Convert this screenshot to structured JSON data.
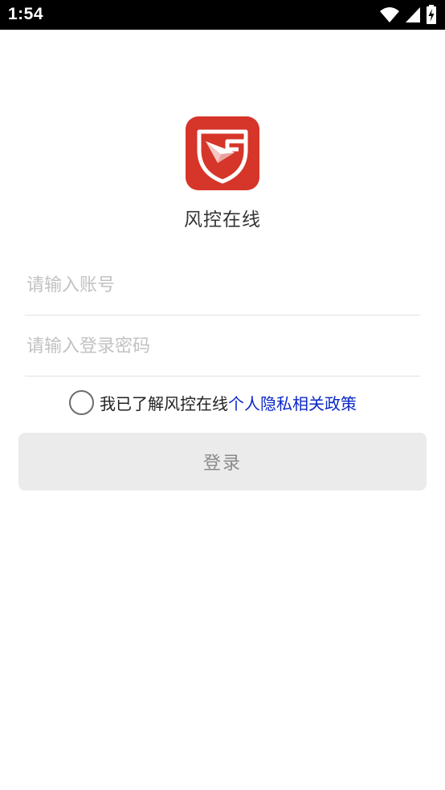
{
  "status_bar": {
    "time": "1:54",
    "icons": [
      "wifi-icon",
      "signal-icon",
      "battery-icon"
    ]
  },
  "app": {
    "logo_icon": "shield-g-paper-plane-logo",
    "name": "风控在线",
    "brand_color": "#d6352a"
  },
  "login_form": {
    "account_placeholder": "请输入账号",
    "account_value": "",
    "password_placeholder": "请输入登录密码",
    "password_value": "",
    "agreement_prefix": "我已了解风控在线",
    "agreement_link": "个人隐私相关政策",
    "agreement_checked": false,
    "login_label": "登录",
    "link_color": "#0b27c9"
  }
}
